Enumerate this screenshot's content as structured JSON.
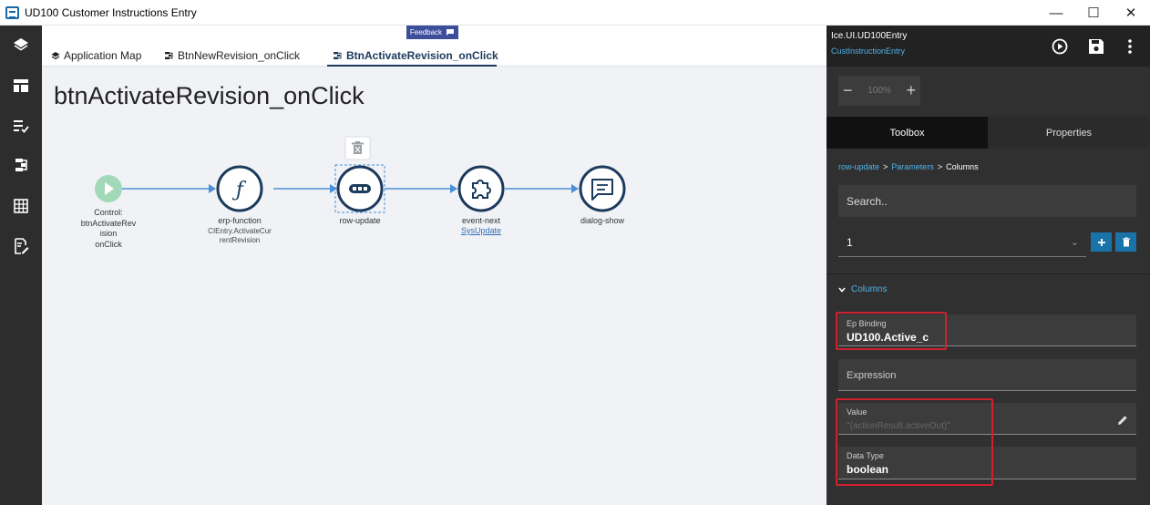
{
  "window": {
    "title": "UD100 Customer Instructions Entry",
    "controls": {
      "minimize": "—",
      "maximize": "☐",
      "close": "✕"
    }
  },
  "rail": {
    "icons": [
      "layers-icon",
      "layout-icon",
      "checklist-icon",
      "workflow-icon",
      "grid-icon",
      "form-edit-icon"
    ]
  },
  "tabs": [
    {
      "label": "Application Map",
      "icon": "layers-icon",
      "active": false
    },
    {
      "label": "BtnNewRevision_onClick",
      "icon": "workflow-icon",
      "active": false
    },
    {
      "label": "BtnActivateRevision_onClick",
      "icon": "workflow-icon",
      "active": true
    }
  ],
  "feedback": {
    "label": "Feedback"
  },
  "page": {
    "title": "btnActivateRevision_onClick"
  },
  "flow": {
    "nodes": [
      {
        "type": "Control",
        "label_lines": [
          "Control:",
          "btnActivateRev",
          "ision",
          "onClick"
        ],
        "icon": "play-icon"
      },
      {
        "type": "erp-function",
        "label": "erp-function",
        "sub_lines": [
          "CIEntry.ActivateCur",
          "rentRevision"
        ],
        "icon": "function-icon"
      },
      {
        "type": "row-update",
        "label": "row-update",
        "icon": "row-update-icon",
        "selected": true
      },
      {
        "type": "event-next",
        "label": "event-next",
        "link": "SysUpdate",
        "icon": "puzzle-icon"
      },
      {
        "type": "dialog-show",
        "label": "dialog-show",
        "icon": "message-icon"
      }
    ],
    "delete_icon": "trash-icon"
  },
  "panel": {
    "header": {
      "title": "Ice.UI.UD100Entry",
      "subtitle": "CustInstructionEntry"
    },
    "header_icons": [
      "run-icon",
      "save-icon",
      "more-vert-icon"
    ],
    "zoom": {
      "minus": "−",
      "value": "100%",
      "plus": "+"
    },
    "tabs": {
      "toolbox": "Toolbox",
      "properties": "Properties"
    },
    "breadcrumb": {
      "link": "row-update",
      "sep": ">",
      "mid": "Parameters",
      "last": "Columns"
    },
    "search": {
      "placeholder": "Search.."
    },
    "select": {
      "value": "1"
    },
    "section": {
      "label": "Columns"
    },
    "fields": {
      "ep_binding": {
        "label": "Ep Binding",
        "value": "UD100.Active_c"
      },
      "expression": {
        "placeholder": "Expression"
      },
      "value": {
        "label": "Value",
        "value": "\"{actionResult.activeOut}\""
      },
      "data_type": {
        "label": "Data Type",
        "value": "boolean"
      }
    }
  },
  "colors": {
    "accent": "#1b3a5c",
    "link": "#4fb3e8",
    "highlight": "#d0212f",
    "node_green": "#a3d9b9"
  }
}
